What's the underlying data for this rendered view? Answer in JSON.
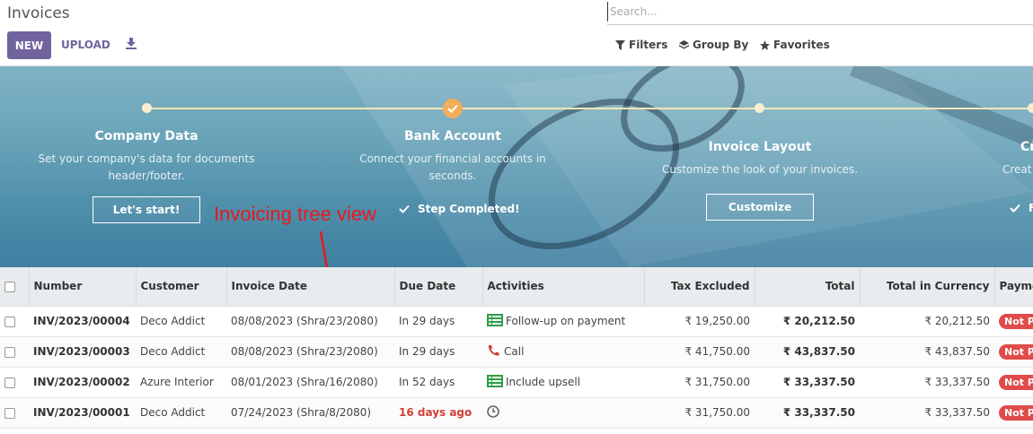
{
  "header": {
    "title": "Invoices",
    "new_label": "NEW",
    "upload_label": "UPLOAD",
    "search_placeholder": "Search...",
    "filters_label": "Filters",
    "group_by_label": "Group By",
    "favorites_label": "Favorites",
    "icons": [
      "download-icon",
      "filter-icon",
      "layers-icon",
      "star-icon"
    ]
  },
  "onboarding": {
    "steps": [
      {
        "title": "Company Data",
        "description": "Set your company's data for documents header/footer.",
        "button": "Let's start!"
      },
      {
        "title": "Bank Account",
        "description": "Connect your financial accounts in seconds.",
        "done_label": "Step Completed!"
      },
      {
        "title": "Invoice Layout",
        "description": "Customize the look of your invoices.",
        "button": "Customize"
      },
      {
        "title": "Cr",
        "description": "Creat",
        "done_label": "F"
      }
    ],
    "colors": {
      "check": "#f1ad5a",
      "line": "#f5e6b4"
    }
  },
  "annotation": {
    "text": "Invoicing tree view",
    "color": "#e8191e"
  },
  "table": {
    "columns": [
      "Number",
      "Customer",
      "Invoice Date",
      "Due Date",
      "Activities",
      "Tax Excluded",
      "Total",
      "Total in Currency",
      "Payme"
    ],
    "rows": [
      {
        "number": "INV/2023/00004",
        "customer": "Deco Addict",
        "invoice_date": "08/08/2023 (Shra/23/2080)",
        "due_date": "In 29 days",
        "activity_icon": "task-list-icon",
        "activity": "Follow-up on payment",
        "tax_excluded": "₹ 19,250.00",
        "total": "₹ 20,212.50",
        "total_currency": "₹ 20,212.50",
        "payment": "Not Pa"
      },
      {
        "number": "INV/2023/00003",
        "customer": "Deco Addict",
        "invoice_date": "08/08/2023 (Shra/23/2080)",
        "due_date": "In 29 days",
        "activity_icon": "phone-icon",
        "activity": "Call",
        "tax_excluded": "₹ 41,750.00",
        "total": "₹ 43,837.50",
        "total_currency": "₹ 43,837.50",
        "payment": "Not Pa"
      },
      {
        "number": "INV/2023/00002",
        "customer": "Azure Interior",
        "invoice_date": "08/01/2023 (Shra/16/2080)",
        "due_date": "In 52 days",
        "activity_icon": "task-list-icon",
        "activity": "Include upsell",
        "tax_excluded": "₹ 31,750.00",
        "total": "₹ 33,337.50",
        "total_currency": "₹ 33,337.50",
        "payment": "Not Pa"
      },
      {
        "number": "INV/2023/00001",
        "customer": "Deco Addict",
        "invoice_date": "07/24/2023 (Shra/8/2080)",
        "due_date": "16 days ago",
        "activity_icon": "clock-icon",
        "activity": "",
        "tax_excluded": "₹ 31,750.00",
        "total": "₹ 33,337.50",
        "total_currency": "₹ 33,337.50",
        "payment": "Not Pa"
      }
    ],
    "colors": {
      "overdue": "#d23f3a",
      "badge": "#e04a4a",
      "header_bg": "#e9ecef"
    }
  }
}
